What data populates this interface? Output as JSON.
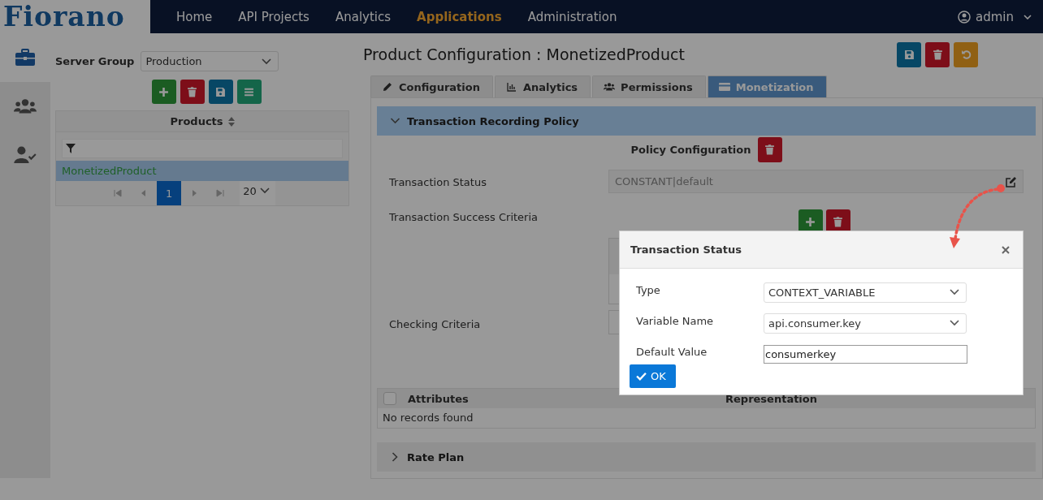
{
  "header": {
    "logo": "Fiorano",
    "nav": [
      {
        "label": "Home",
        "selected": false
      },
      {
        "label": "API Projects",
        "selected": false
      },
      {
        "label": "Analytics",
        "selected": false
      },
      {
        "label": "Applications",
        "selected": true
      },
      {
        "label": "Administration",
        "selected": false
      }
    ],
    "user": "admin"
  },
  "rail": [
    {
      "kind": "briefcase",
      "selected": true
    },
    {
      "kind": "users",
      "selected": false
    },
    {
      "kind": "user-check",
      "selected": false
    }
  ],
  "left_panel": {
    "server_group_label": "Server Group",
    "server_group": "Production",
    "toolbar": [
      {
        "kind": "add"
      },
      {
        "kind": "delete"
      },
      {
        "kind": "save"
      },
      {
        "kind": "list"
      }
    ],
    "table": {
      "column": "Products",
      "rows": [
        {
          "name": "MonetizedProduct",
          "selected": true
        }
      ]
    },
    "pager": {
      "pages": [
        {
          "label": "1",
          "selected": true
        }
      ],
      "page_size": "20"
    }
  },
  "main": {
    "title": "Product Configuration : MonetizedProduct",
    "actions": [
      {
        "kind": "save"
      },
      {
        "kind": "delete"
      },
      {
        "kind": "undo"
      }
    ],
    "tabs": [
      {
        "label": "Configuration",
        "kind": "pencil",
        "selected": false
      },
      {
        "label": "Analytics",
        "kind": "chart",
        "selected": false
      },
      {
        "label": "Permissions",
        "kind": "users",
        "selected": false
      },
      {
        "label": "Monetization",
        "kind": "card",
        "selected": true
      }
    ],
    "policy_section": {
      "title": "Transaction Recording Policy",
      "expanded": true,
      "heading": "Policy Configuration",
      "transaction_status_label": "Transaction Status",
      "transaction_status": "CONSTANT|default",
      "success_criteria_label": "Transaction Success Criteria",
      "checking_criteria_label": "Checking Criteria",
      "attributes_table": {
        "all_checked": false,
        "columns": [
          "Attributes",
          "Representation"
        ],
        "empty": "No records found"
      }
    },
    "rate_plan_section": {
      "title": "Rate Plan",
      "expanded": false
    }
  },
  "dialog": {
    "title": "Transaction Status",
    "fields": [
      {
        "label": "Type",
        "kind": "select",
        "value": "CONTEXT_VARIABLE"
      },
      {
        "label": "Variable Name",
        "kind": "select",
        "value": "api.consumer.key"
      },
      {
        "label": "Default Value",
        "kind": "input",
        "value": "consumerkey"
      }
    ],
    "ok": "OK"
  }
}
